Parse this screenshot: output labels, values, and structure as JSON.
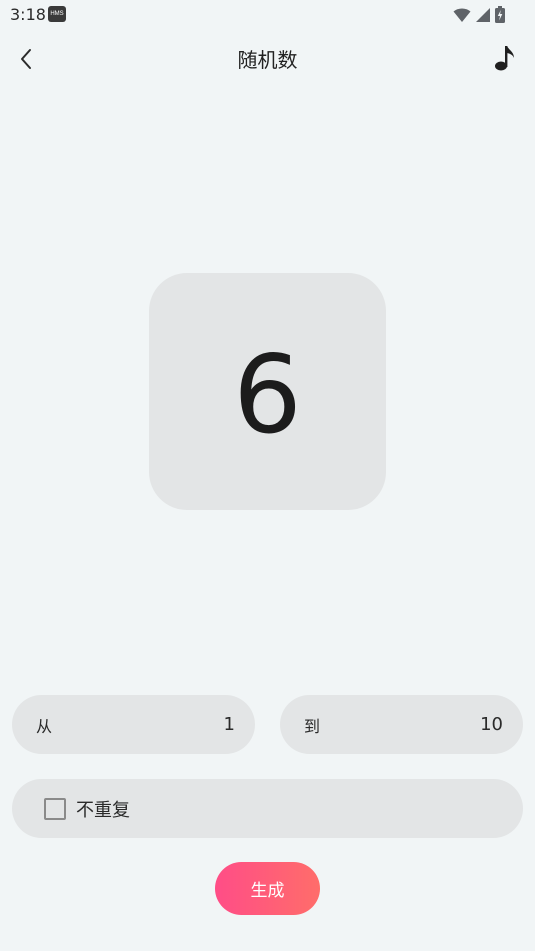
{
  "status_bar": {
    "time": "3:18",
    "badge": "HMS",
    "icons": [
      "wifi-icon",
      "cell-signal-icon",
      "battery-charging-icon"
    ]
  },
  "app_bar": {
    "back_icon": "chevron-left-icon",
    "title": "随机数",
    "music_icon": "music-note-icon"
  },
  "result": {
    "value": "6"
  },
  "range": {
    "from_label": "从",
    "from_value": "1",
    "to_label": "到",
    "to_value": "10"
  },
  "options": {
    "no_repeat_label": "不重复",
    "no_repeat_checked": false
  },
  "actions": {
    "generate_label": "生成"
  },
  "colors": {
    "background": "#f1f5f6",
    "surface": "#e3e5e6",
    "accent_start": "#ff4d87",
    "accent_end": "#ff6d6a"
  }
}
